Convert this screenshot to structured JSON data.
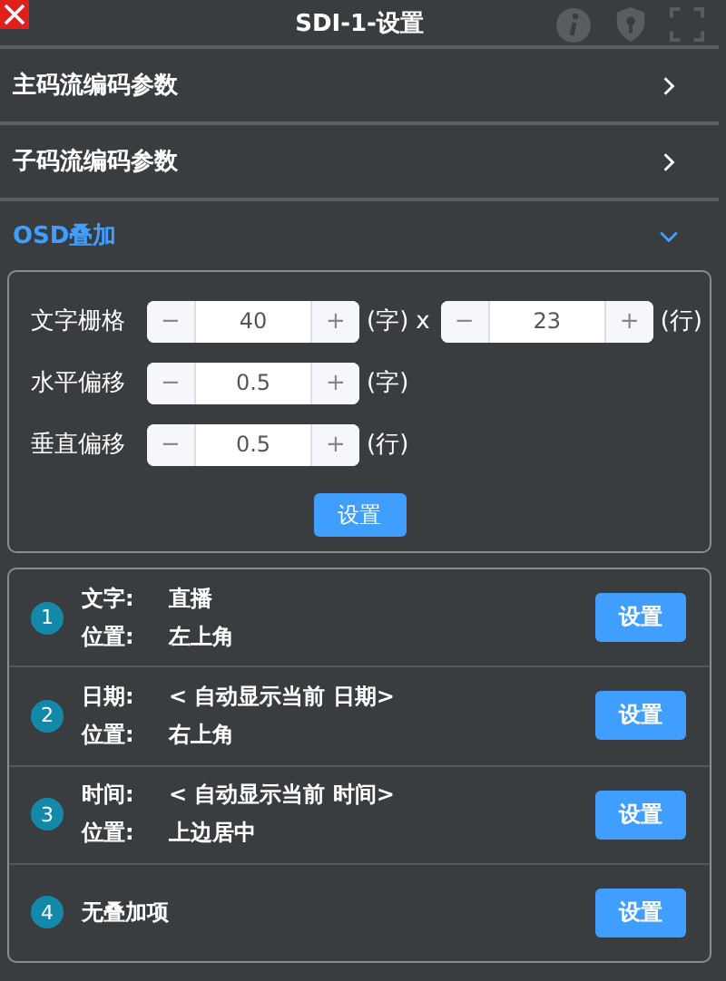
{
  "window": {
    "title": "SDI-1-设置"
  },
  "sections": [
    {
      "label": "主码流编码参数",
      "expanded": false
    },
    {
      "label": "子码流编码参数",
      "expanded": false
    },
    {
      "label": "OSD叠加",
      "expanded": true
    }
  ],
  "osd_form": {
    "fields": [
      {
        "label": "文字栅格",
        "inputs": [
          {
            "minus": "−",
            "value": "40",
            "plus": "+",
            "unit": "(字)",
            "separator": "x"
          },
          {
            "minus": "−",
            "value": "23",
            "plus": "+",
            "unit": "(行)"
          }
        ]
      },
      {
        "label": "水平偏移",
        "inputs": [
          {
            "minus": "−",
            "value": "0.5",
            "plus": "+",
            "unit": "(字)"
          }
        ]
      },
      {
        "label": "垂直偏移",
        "inputs": [
          {
            "minus": "−",
            "value": "0.5",
            "plus": "+",
            "unit": "(行)"
          }
        ]
      }
    ],
    "button": "设置"
  },
  "overlays": [
    {
      "index": "1",
      "lines": [
        {
          "key": "文字:",
          "value": "直播"
        },
        {
          "key": "位置:",
          "value": "左上角"
        }
      ],
      "button": "设置"
    },
    {
      "index": "2",
      "lines": [
        {
          "key": "日期:",
          "value": "< 自动显示当前 日期>"
        },
        {
          "key": "位置:",
          "value": "右上角"
        }
      ],
      "button": "设置"
    },
    {
      "index": "3",
      "lines": [
        {
          "key": "时间:",
          "value": "< 自动显示当前 时间>"
        },
        {
          "key": "位置:",
          "value": "上边居中"
        }
      ],
      "button": "设置"
    },
    {
      "index": "4",
      "lines": [
        {
          "key": "无叠加项"
        }
      ],
      "button": "设置"
    }
  ]
}
